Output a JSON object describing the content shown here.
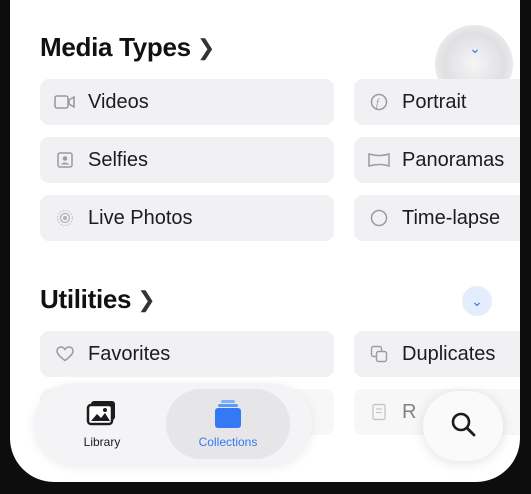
{
  "media_types": {
    "title": "Media Types",
    "items": [
      {
        "label": "Videos",
        "icon": "video-icon"
      },
      {
        "label": "Portrait",
        "icon": "portrait-icon"
      },
      {
        "label": "Selfies",
        "icon": "selfie-icon"
      },
      {
        "label": "Panoramas",
        "icon": "panorama-icon"
      },
      {
        "label": "Live Photos",
        "icon": "live-photo-icon"
      },
      {
        "label": "Time-lapse",
        "icon": "timelapse-icon"
      }
    ]
  },
  "utilities": {
    "title": "Utilities",
    "items": [
      {
        "label": "Favorites",
        "icon": "heart-icon"
      },
      {
        "label": "Duplicates",
        "icon": "duplicates-icon"
      },
      {
        "label": "R",
        "icon": "receipt-icon"
      }
    ]
  },
  "tab_bar": {
    "library_label": "Library",
    "collections_label": "Collections"
  },
  "colors": {
    "accent": "#3478f6",
    "tile_bg": "#f1f1f3"
  }
}
